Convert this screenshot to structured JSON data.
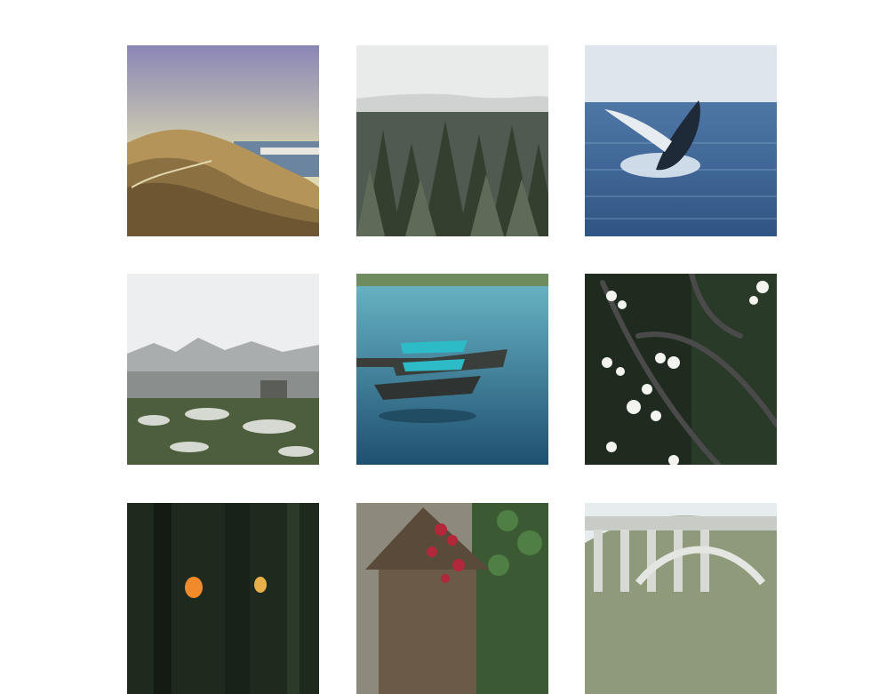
{
  "gallery": {
    "photos": [
      {
        "subject": "dunes-coast"
      },
      {
        "subject": "pine-forest"
      },
      {
        "subject": "humpback-whale"
      },
      {
        "subject": "rocky-mountains"
      },
      {
        "subject": "boats-on-lake"
      },
      {
        "subject": "white-blossoms"
      },
      {
        "subject": "campfire-forest"
      },
      {
        "subject": "ivy-cabin"
      },
      {
        "subject": "arch-bridge"
      }
    ]
  }
}
